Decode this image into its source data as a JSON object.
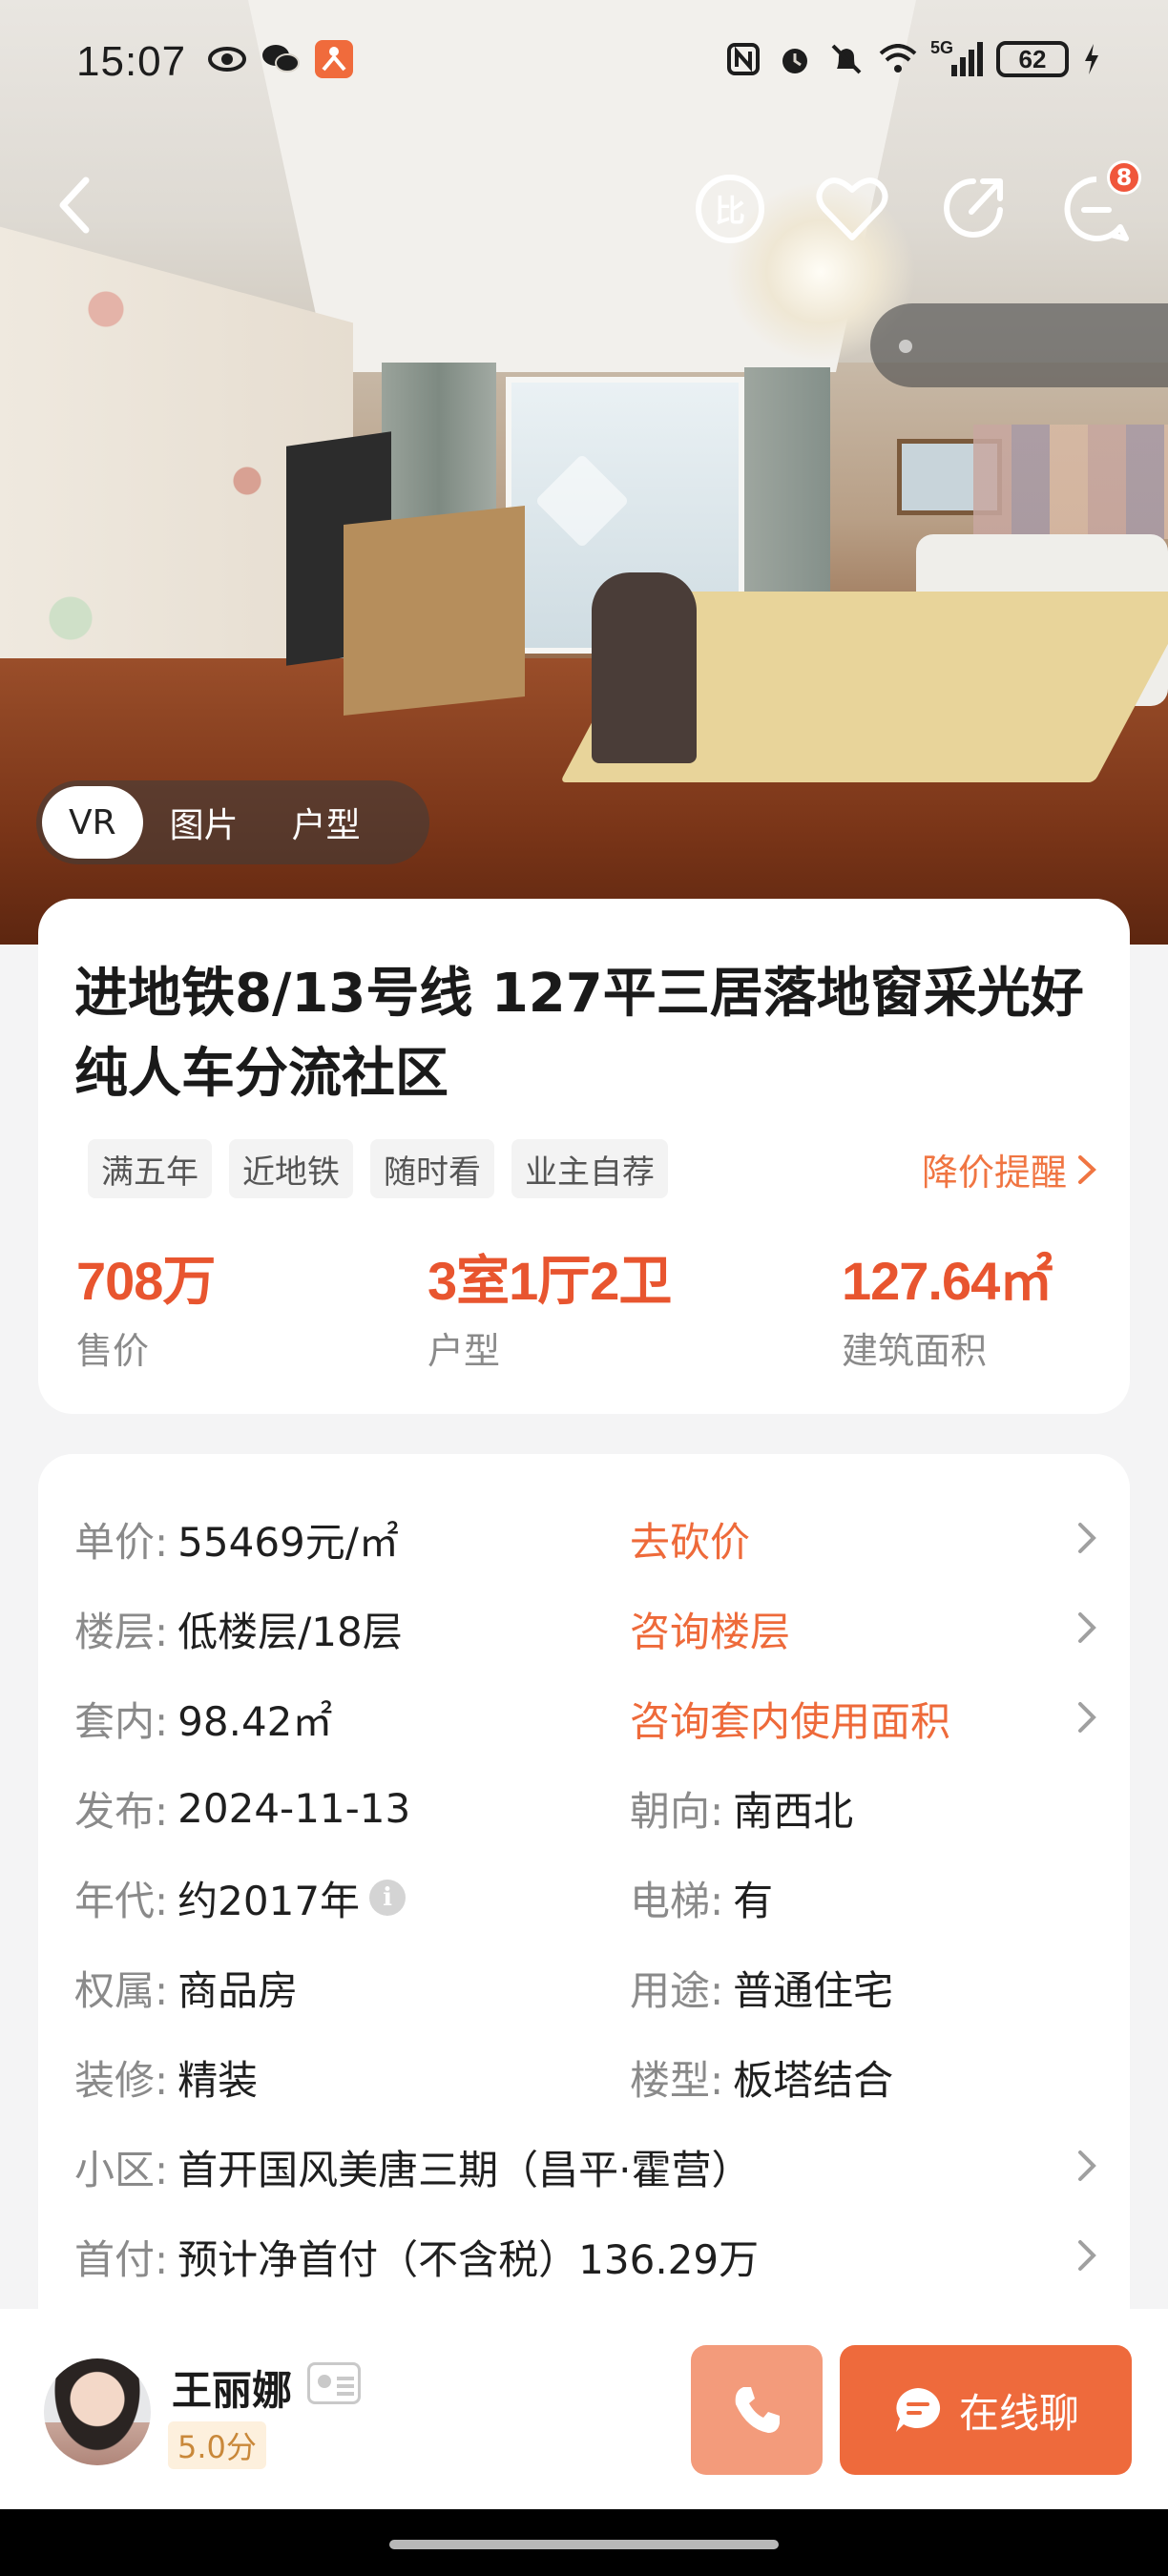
{
  "status_bar": {
    "time": "15:07",
    "network": "5G",
    "battery": "62"
  },
  "gallery": {
    "tabs": [
      {
        "label": "VR",
        "active": true
      },
      {
        "label": "图片",
        "active": false
      },
      {
        "label": "户型",
        "active": false
      }
    ]
  },
  "header": {
    "message_count": "8",
    "compare_label": "比"
  },
  "listing": {
    "title": "进地铁8/13号线 127平三居落地窗采光好纯人车分流社区",
    "tags": [
      "满五年",
      "近地铁",
      "随时看",
      "业主自荐"
    ],
    "price_alert": "降价提醒",
    "stats": [
      {
        "value": "708万",
        "label": "售价"
      },
      {
        "value": "3室1厅2卫",
        "label": "户型"
      },
      {
        "value": "127.64㎡",
        "label": "建筑面积"
      }
    ]
  },
  "details": {
    "unit_price": {
      "label": "单价:",
      "value": "55469元/㎡",
      "action": "去砍价"
    },
    "floor": {
      "label": "楼层:",
      "value": "低楼层/18层",
      "action": "咨询楼层"
    },
    "inner_area": {
      "label": "套内:",
      "value": "98.42㎡",
      "action": "咨询套内使用面积"
    },
    "published": {
      "label": "发布:",
      "value": "2024-11-13"
    },
    "orientation": {
      "label": "朝向:",
      "value": "南西北"
    },
    "year": {
      "label": "年代:",
      "value": "约2017年"
    },
    "elevator": {
      "label": "电梯:",
      "value": "有"
    },
    "ownership": {
      "label": "权属:",
      "value": "商品房"
    },
    "usage": {
      "label": "用途:",
      "value": "普通住宅"
    },
    "decoration": {
      "label": "装修:",
      "value": "精装"
    },
    "building_type": {
      "label": "楼型:",
      "value": "板塔结合"
    },
    "community": {
      "label": "小区:",
      "value": "首开国风美唐三期（昌平·霍营）"
    },
    "down_payment": {
      "label": "首付:",
      "value": "预计净首付（不含税）136.29万"
    }
  },
  "agent": {
    "name": "王丽娜",
    "score": "5.0分",
    "chat_label": "在线聊"
  },
  "colors": {
    "accent": "#ee6a3c",
    "price_red": "#e8552f",
    "call_button": "#f39b7b"
  }
}
